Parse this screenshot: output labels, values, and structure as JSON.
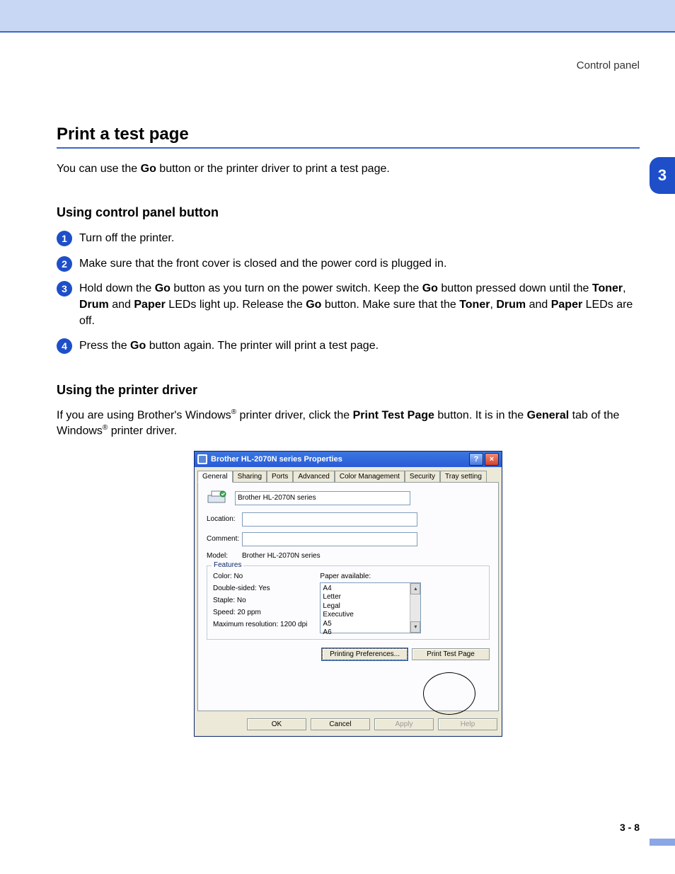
{
  "header": {
    "section_label": "Control panel"
  },
  "title": "Print a test page",
  "intro": {
    "pre": "You can use the ",
    "btn": "Go",
    "post": " button or the printer driver to print a test page."
  },
  "section1": {
    "heading": "Using control panel button",
    "steps": {
      "1": "Turn off the printer.",
      "2": "Make sure that the front cover is closed and the power cord is plugged in.",
      "3": {
        "a": "Hold down the ",
        "b": "Go",
        "c": " button as you turn on the power switch. Keep the ",
        "d": "Go",
        "e": " button pressed down until the ",
        "f": "Toner",
        "g": ", ",
        "h": "Drum",
        "i": " and ",
        "j": "Paper",
        "k": " LEDs light up. Release the ",
        "l": "Go",
        "m": " button. Make sure that the ",
        "n": "Toner",
        "o": ", ",
        "p": "Drum",
        "q": " and ",
        "r": "Paper",
        "s": " LEDs are off."
      },
      "4": {
        "a": "Press the ",
        "b": "Go",
        "c": " button again. The printer will print a test page."
      }
    }
  },
  "section2": {
    "heading": "Using the printer driver",
    "para": {
      "a": "If you are using Brother's Windows",
      "b": " printer driver, click the ",
      "c": "Print Test Page",
      "d": " button. It is in the ",
      "e": "General",
      "f": " tab of the Windows",
      "g": " printer driver."
    }
  },
  "dialog": {
    "title": "Brother HL-2070N series Properties",
    "tabs": [
      "General",
      "Sharing",
      "Ports",
      "Advanced",
      "Color Management",
      "Security",
      "Tray setting"
    ],
    "printer_name": "Brother HL-2070N series",
    "labels": {
      "location": "Location:",
      "comment": "Comment:",
      "model": "Model:"
    },
    "model_value": "Brother HL-2070N series",
    "features_legend": "Features",
    "features": {
      "color": "Color: No",
      "double": "Double-sided: Yes",
      "staple": "Staple: No",
      "speed": "Speed: 20 ppm",
      "res": "Maximum resolution: 1200 dpi",
      "paper_label": "Paper available:",
      "paper": [
        "A4",
        "Letter",
        "Legal",
        "Executive",
        "A5",
        "A6"
      ]
    },
    "buttons": {
      "prefs": "Printing Preferences...",
      "test": "Print Test Page",
      "ok": "OK",
      "cancel": "Cancel",
      "apply": "Apply",
      "help": "Help"
    }
  },
  "chapter": "3",
  "page_number": "3 - 8"
}
